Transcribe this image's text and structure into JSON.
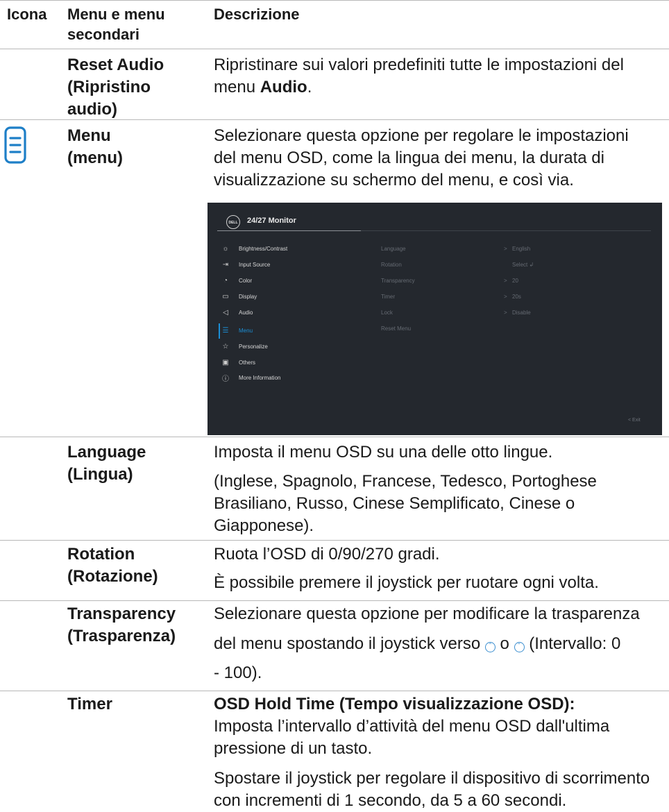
{
  "header": {
    "col_icon": "Icona",
    "col_menu_1": "Menu e menu",
    "col_menu_2": "secondari",
    "col_desc": "Descrizione"
  },
  "rows": {
    "reset_audio": {
      "name_1": "Reset Audio",
      "name_2": "(Ripristino",
      "name_3": "audio)",
      "desc_1": "Ripristinare sui valori predefiniti tutte le impostazioni del",
      "desc_2_pre": "menu ",
      "desc_2_bold": "Audio",
      "desc_2_post": "."
    },
    "menu": {
      "icon": "menu-list-icon",
      "name_1": "Menu",
      "name_2": "(menu)",
      "desc_1": "Selezionare questa opzione per regolare le impostazioni",
      "desc_2": "del menu OSD, come la lingua dei menu, la durata di",
      "desc_3": "visualizzazione su schermo del menu, e così via."
    },
    "language": {
      "name_1": "Language",
      "name_2": "(Lingua)",
      "desc_1": "Imposta il menu OSD su una delle otto lingue.",
      "desc_2": "(Inglese, Spagnolo, Francese, Tedesco, Portoghese",
      "desc_3": "Brasiliano, Russo, Cinese Semplificato, Cinese o",
      "desc_4": "Giapponese)."
    },
    "rotation": {
      "name_1": "Rotation",
      "name_2": "(Rotazione)",
      "desc_1": "Ruota l’OSD di 0/90/270 gradi.",
      "desc_2": "È possibile premere il joystick per ruotare ogni volta."
    },
    "transparency": {
      "name_1": "Transparency",
      "name_2": "(Trasparenza)",
      "desc_1": "Selezionare questa opzione per modificare la trasparenza",
      "desc_2_pre": "del menu spostando il joystick verso",
      "desc_2_mid": "o",
      "desc_2_post": "(Intervallo: 0",
      "desc_3": "- 100).",
      "up_icon": "joystick-up-icon",
      "down_icon": "joystick-down-icon"
    },
    "timer": {
      "name_1": "Timer",
      "desc_bold": "OSD Hold Time (Tempo visualizzazione OSD):",
      "desc_1": "Imposta l’intervallo d’attività del menu OSD dall'ultima",
      "desc_2": "pressione di un tasto.",
      "desc_3": "Spostare il joystick per regolare il dispositivo di scorrimento",
      "desc_4": "con incrementi di 1 secondo, da 5 a 60 secondi."
    }
  },
  "osd": {
    "logo": "DELL",
    "title": "24/27 Monitor",
    "menu_items": [
      {
        "label": "Brightness/Contrast",
        "icon": "brightness-icon"
      },
      {
        "label": "Input Source",
        "icon": "input-source-icon"
      },
      {
        "label": "Color",
        "icon": "color-palette-icon"
      },
      {
        "label": "Display",
        "icon": "display-icon"
      },
      {
        "label": "Audio",
        "icon": "speaker-icon"
      },
      {
        "label": "Menu",
        "icon": "menu-list-icon",
        "active": true
      },
      {
        "label": "Personalize",
        "icon": "star-icon"
      },
      {
        "label": "Others",
        "icon": "others-icon"
      },
      {
        "label": "More Information",
        "icon": "info-icon"
      }
    ],
    "submenu": [
      {
        "label": "Language",
        "arrow": ">",
        "value": "English"
      },
      {
        "label": "Rotation",
        "arrow": "",
        "value": "Select ↲"
      },
      {
        "label": "Transparency",
        "arrow": ">",
        "value": "20"
      },
      {
        "label": "Timer",
        "arrow": ">",
        "value": "20s"
      },
      {
        "label": "Lock",
        "arrow": ">",
        "value": "Disable"
      },
      {
        "label": "Reset Menu",
        "arrow": "",
        "value": ""
      }
    ],
    "exit": "<  Exit",
    "accent_color": "#1b8fd6",
    "background_color": "#24282e"
  }
}
